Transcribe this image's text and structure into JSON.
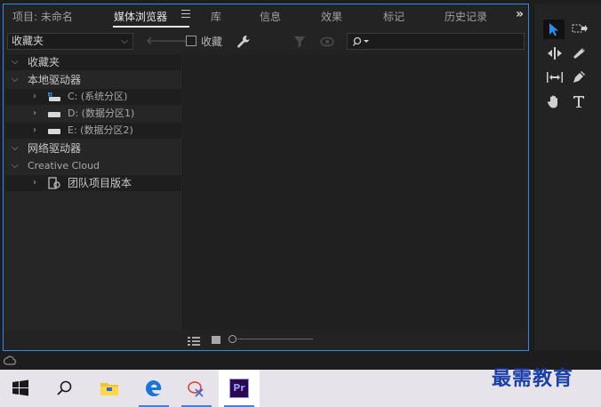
{
  "tabs": [
    {
      "label": "项目: 未命名",
      "active": false
    },
    {
      "label": "媒体浏览器",
      "active": true
    },
    {
      "label": "库",
      "active": false
    },
    {
      "label": "信息",
      "active": false
    },
    {
      "label": "效果",
      "active": false
    },
    {
      "label": "标记",
      "active": false
    },
    {
      "label": "历史记录",
      "active": false
    }
  ],
  "tab_overflow": "»",
  "toolbar": {
    "favorites_select": "收藏夹",
    "collect_label": "收藏",
    "collect_checked": false
  },
  "tree": [
    {
      "label": "收藏夹",
      "expanded": true,
      "indent": 0
    },
    {
      "label": "本地驱动器",
      "expanded": true,
      "indent": 0
    },
    {
      "label": "C: (系统分区)",
      "expanded": false,
      "indent": 1,
      "icon": "system-drive-icon"
    },
    {
      "label": "D: (数据分区1)",
      "expanded": false,
      "indent": 1,
      "icon": "hard-drive-icon"
    },
    {
      "label": "E: (数据分区2)",
      "expanded": false,
      "indent": 1,
      "icon": "hard-drive-icon"
    },
    {
      "label": "网络驱动器",
      "expanded": true,
      "indent": 0
    },
    {
      "label": "Creative Cloud",
      "expanded": true,
      "indent": 0
    },
    {
      "label": "团队项目版本",
      "expanded": false,
      "indent": 1,
      "icon": "team-project-icon"
    }
  ],
  "tools": [
    "selection-tool-icon",
    "track-select-forward-icon",
    "ripple-edit-icon",
    "razor-icon",
    "slip-icon",
    "pen-icon",
    "hand-icon",
    "type-icon"
  ],
  "taskbar": {
    "items": [
      "windows-start-icon",
      "search-icon",
      "file-explorer-icon",
      "edge-icon",
      "snipping-tool-icon",
      "premiere-pro-icon"
    ],
    "premiere_label": "Pr"
  },
  "watermark": "最需教育",
  "colors": {
    "accent": "#2d8ceb",
    "premiere": "#9999ff",
    "premiere_bg": "#2a0a4a"
  }
}
